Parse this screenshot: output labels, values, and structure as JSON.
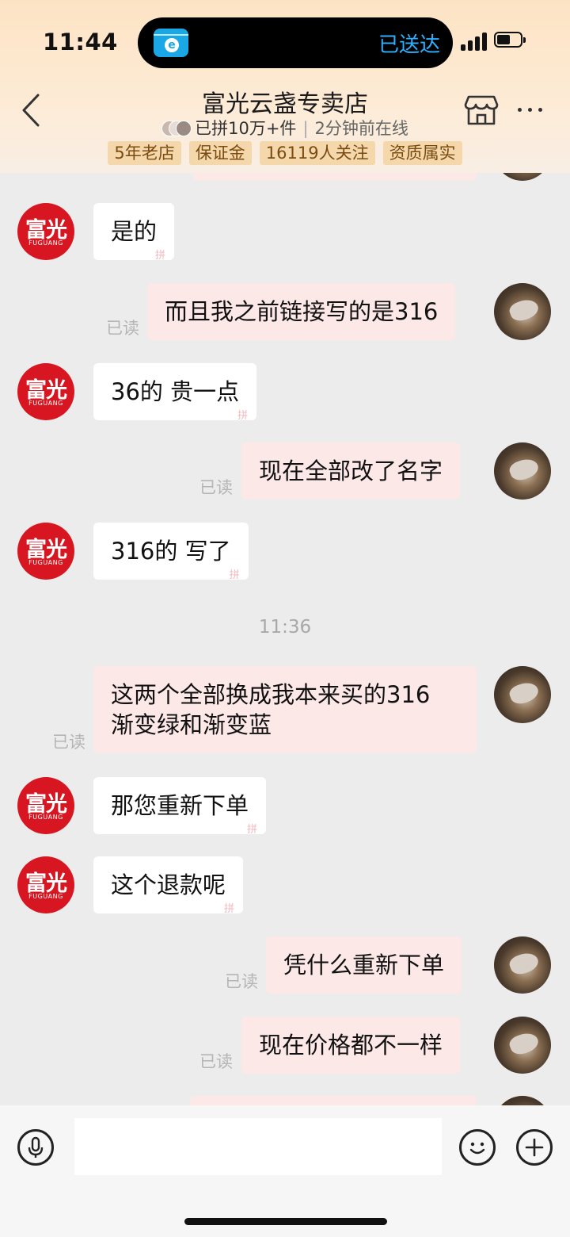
{
  "status_bar": {
    "time": "11:44",
    "island_text": "已送达",
    "island_app_glyph": "e"
  },
  "header": {
    "title": "富光云盏专卖店",
    "sold": "已拼10万+件",
    "online": "2分钟前在线",
    "badges": [
      "5年老店",
      "保证金",
      "16119人关注",
      "资质属实"
    ],
    "icons": {
      "back": "chevron-left-icon",
      "shop": "store-icon",
      "more": "more-dots-icon"
    }
  },
  "shop_avatar": {
    "cn": "富光",
    "en": "FUGUANG"
  },
  "pin_mark": "拼",
  "messages": [
    {
      "type": "in",
      "text": "是的"
    },
    {
      "type": "out",
      "text": "而且我之前链接写的是316",
      "read": "已读"
    },
    {
      "type": "in",
      "text": "36的 贵一点"
    },
    {
      "type": "out",
      "text": "现在全部改了名字",
      "read": "已读"
    },
    {
      "type": "in",
      "text": "316的 写了"
    },
    {
      "type": "time",
      "text": "11:36"
    },
    {
      "type": "out",
      "lines": [
        "这两个全部换成我本来买的316",
        "渐变绿和渐变蓝"
      ],
      "read": "已读"
    },
    {
      "type": "in",
      "text": "那您重新下单"
    },
    {
      "type": "in",
      "text": "这个退款呢"
    },
    {
      "type": "out",
      "text": "凭什么重新下单",
      "read": "已读"
    },
    {
      "type": "out",
      "text": "现在价格都不一样",
      "read": "已读"
    }
  ],
  "input": {
    "placeholder": "",
    "icons": [
      "microphone-icon",
      "emoji-icon",
      "plus-icon"
    ]
  },
  "colors": {
    "header_bg": "#fde3c4",
    "badge_bg": "#f4d8ab",
    "out_bubble": "#fde8e8",
    "shop_red": "#d81621",
    "island_text": "#2db0ff"
  }
}
